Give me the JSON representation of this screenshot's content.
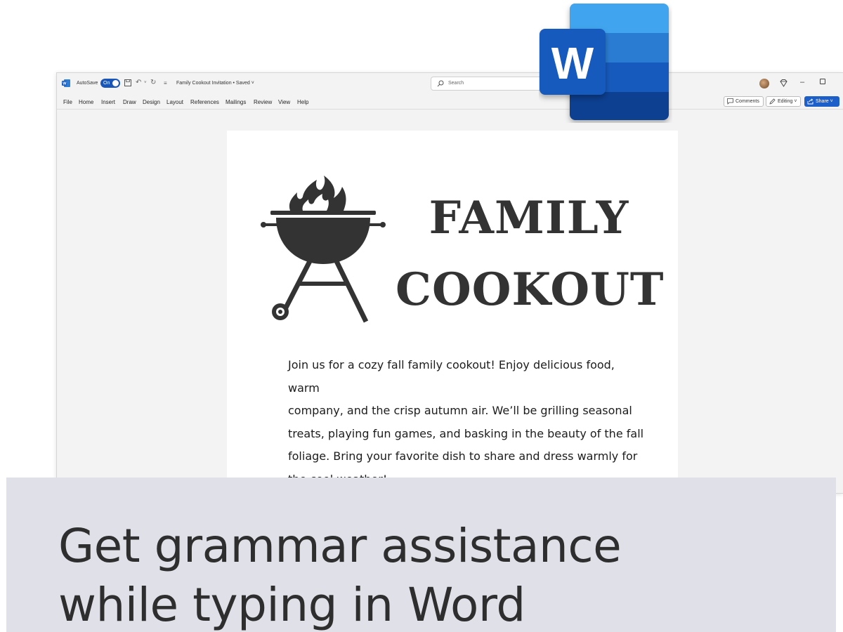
{
  "titlebar": {
    "autosave_label": "AutoSave",
    "autosave_state": "On",
    "document_title": "Family Cookout Invitation • Saved ˅",
    "search_placeholder": "Search"
  },
  "menu": {
    "items": [
      "File",
      "Home",
      "Insert",
      "Draw",
      "Design",
      "Layout",
      "References",
      "Mailings",
      "Review",
      "View",
      "Help"
    ],
    "comments_label": "Comments",
    "editing_label": "Editing ˅",
    "share_label": "Share ˅"
  },
  "document": {
    "headline_line1": "FAMILY",
    "headline_line2": "COOKOUT",
    "body_lines": [
      "Join us for a cozy fall family cookout! Enjoy delicious food, warm",
      "company, and the crisp autumn air. We’ll be grilling seasonal",
      "treats, playing fun games, and basking in the beauty of the fall",
      "foliage. Bring your favorite dish to share and dress warmly for",
      "the cool weather!"
    ]
  },
  "caption": {
    "line1": "Get grammar assistance",
    "line2": "while typing in Word"
  },
  "colors": {
    "word_blue": "#185abd",
    "share_blue": "#1c5fc9",
    "caption_band": "#e0e0e9"
  },
  "icons": [
    "word-app-icon",
    "save-icon",
    "undo-icon",
    "redo-icon",
    "search-icon",
    "diamond-icon",
    "minimize-icon",
    "maximize-icon",
    "comments-icon",
    "pencil-icon",
    "share-icon",
    "grill-icon",
    "word-logo-icon"
  ]
}
